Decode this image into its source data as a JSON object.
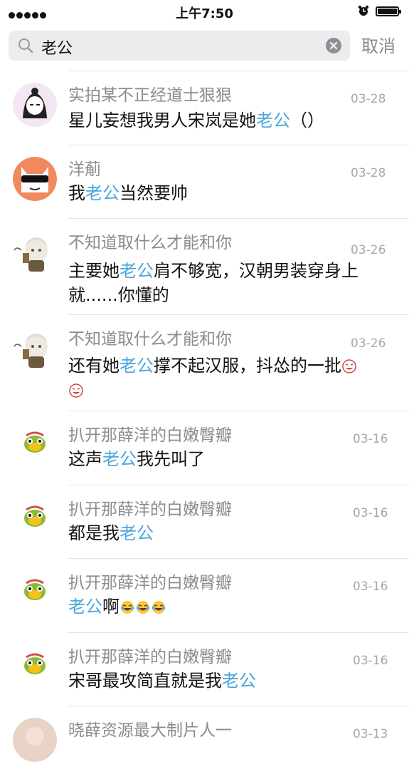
{
  "status_bar": {
    "time": "上午7:50"
  },
  "search": {
    "query": "老公"
  },
  "cancel_label": "取消",
  "results": [
    {
      "name": "实拍某不正经道士狠狠",
      "date": "03-28",
      "pre": "星儿妄想我男人宋岚是她",
      "hl": "老公",
      "post": "（）"
    },
    {
      "name": "洋葪",
      "date": "03-28",
      "pre": " 我",
      "hl": "老公",
      "post": "当然要帅"
    },
    {
      "name": "不知道取什么才能和你",
      "date": "03-26",
      "pre": "主要她",
      "hl": "老公",
      "post": "肩不够宽，汉朝男装穿身上就......你懂的"
    },
    {
      "name": "不知道取什么才能和你",
      "date": "03-26",
      "pre": "还有她",
      "hl": "老公",
      "post": "撑不起汉服，抖怂的一批"
    },
    {
      "name": "扒开那薛洋的白嫩臀瓣",
      "date": "03-16",
      "pre": " 这声",
      "hl": "老公",
      "post": "我先叫了"
    },
    {
      "name": "扒开那薛洋的白嫩臀瓣",
      "date": "03-16",
      "pre": "都是我",
      "hl": "老公",
      "post": ""
    },
    {
      "name": "扒开那薛洋的白嫩臀瓣",
      "date": "03-16",
      "pre": "",
      "hl": "老公",
      "post": "啊"
    },
    {
      "name": "扒开那薛洋的白嫩臀瓣",
      "date": "03-16",
      "pre": "宋哥最攻简直就是我",
      "hl": "老公",
      "post": ""
    },
    {
      "name": "晓薛资源最大制片人一",
      "date": "03-13",
      "pre": "",
      "hl": "",
      "post": ""
    }
  ],
  "colors": {
    "highlight": "#4aa6de",
    "name": "#8c8c8c",
    "date": "#a8a8a8"
  },
  "icons": [
    "search-icon",
    "clear-icon",
    "alarm-icon",
    "battery-icon",
    "cry-laugh-emoji",
    "tears-emoji"
  ]
}
